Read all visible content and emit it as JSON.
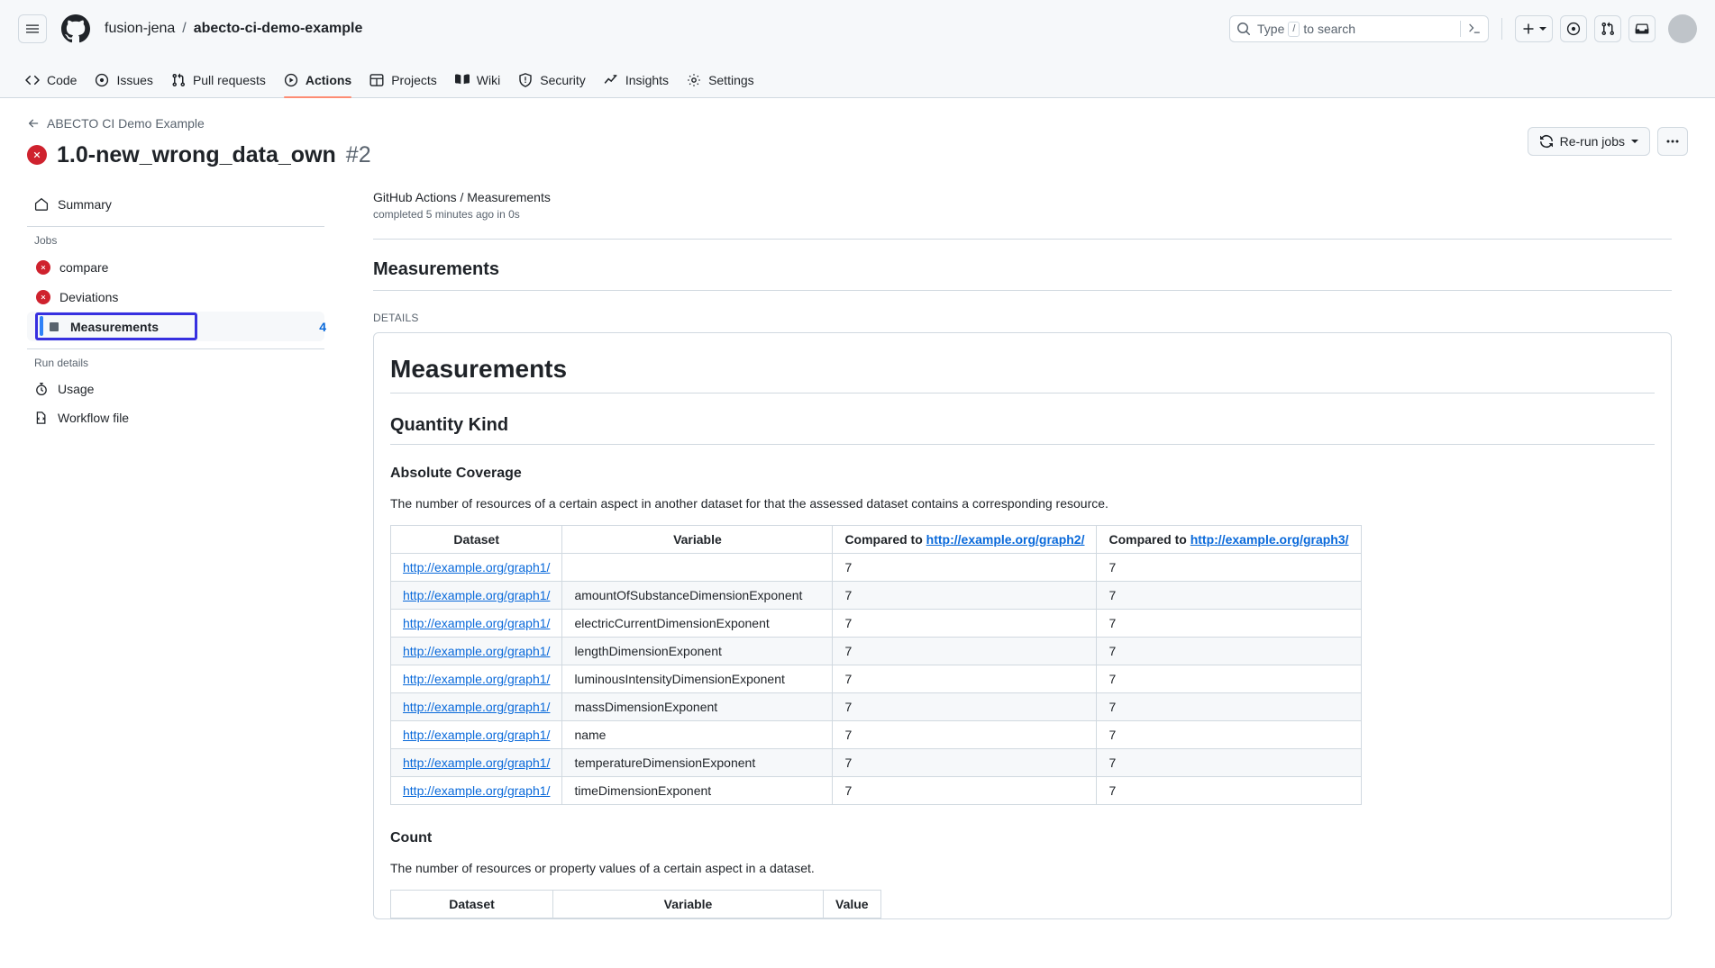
{
  "header": {
    "menu_icon": "hamburger-icon",
    "logo_icon": "github-logo-icon",
    "owner": "fusion-jena",
    "separator": "/",
    "repo": "abecto-ci-demo-example",
    "search_placeholder_pre": "Type",
    "search_key": "/",
    "search_placeholder_post": "to search",
    "terminal_icon": "terminal-icon",
    "create_new_label": "+",
    "issues_icon": "issue-opened-icon",
    "pulls_icon": "git-pull-request-icon",
    "inbox_icon": "inbox-icon",
    "avatar": "user-avatar"
  },
  "repo_nav": {
    "tabs": [
      {
        "label": "Code",
        "icon": "code-icon",
        "active": false
      },
      {
        "label": "Issues",
        "icon": "issue-opened-icon",
        "active": false
      },
      {
        "label": "Pull requests",
        "icon": "git-pull-request-icon",
        "active": false
      },
      {
        "label": "Actions",
        "icon": "play-icon",
        "active": true
      },
      {
        "label": "Projects",
        "icon": "table-icon",
        "active": false
      },
      {
        "label": "Wiki",
        "icon": "book-icon",
        "active": false
      },
      {
        "label": "Security",
        "icon": "shield-icon",
        "active": false
      },
      {
        "label": "Insights",
        "icon": "graph-icon",
        "active": false
      },
      {
        "label": "Settings",
        "icon": "gear-icon",
        "active": false
      }
    ],
    "active_accent": "#fd8c73"
  },
  "run": {
    "back_label": "ABECTO CI Demo Example",
    "back_icon": "arrow-left-icon",
    "status_icon": "x-circle-fill-icon",
    "status_color": "#cf222e",
    "title": "1.0-new_wrong_data_own",
    "number": "#2",
    "rerun_label": "Re-run jobs",
    "rerun_icon": "sync-icon",
    "more_label": "•••"
  },
  "sidebar": {
    "summary": {
      "label": "Summary",
      "icon": "home-icon"
    },
    "jobs_heading": "Jobs",
    "jobs": [
      {
        "label": "compare",
        "icon": "x-circle-fill-icon",
        "status": "failure",
        "count": "",
        "selected": false
      },
      {
        "label": "Deviations",
        "icon": "x-circle-fill-icon",
        "status": "failure",
        "count": "",
        "selected": false
      },
      {
        "label": "Measurements",
        "icon": "neutral-square-icon",
        "status": "neutral",
        "count": "4",
        "selected": true
      }
    ],
    "run_details_heading": "Run details",
    "run_details": [
      {
        "label": "Usage",
        "icon": "stopwatch-icon"
      },
      {
        "label": "Workflow file",
        "icon": "workflow-file-icon"
      }
    ],
    "focus_color": "#3730e0",
    "selected_bar_color": "#2f81f7",
    "count_color": "#0969da"
  },
  "main": {
    "log_title": "GitHub Actions / Measurements",
    "log_subtitle": "completed 5 minutes ago in 0s",
    "section_title": "Measurements",
    "details_label": "DETAILS",
    "doc": {
      "h1": "Measurements",
      "h2": "Quantity Kind",
      "sections": [
        {
          "h3": "Absolute Coverage",
          "paragraph": "The number of resources of a certain aspect in another dataset for that the assessed dataset contains a corresponding resource.",
          "table": {
            "headers": [
              {
                "text": "Dataset",
                "link": ""
              },
              {
                "text": "Variable",
                "link": ""
              },
              {
                "text": "Compared to ",
                "link": "http://example.org/graph2/"
              },
              {
                "text": "Compared to ",
                "link": "http://example.org/graph3/"
              }
            ],
            "rows": [
              {
                "dataset": "http://example.org/graph1/",
                "variable": "",
                "g2": "7",
                "g3": "7"
              },
              {
                "dataset": "http://example.org/graph1/",
                "variable": "amountOfSubstanceDimensionExponent",
                "g2": "7",
                "g3": "7"
              },
              {
                "dataset": "http://example.org/graph1/",
                "variable": "electricCurrentDimensionExponent",
                "g2": "7",
                "g3": "7"
              },
              {
                "dataset": "http://example.org/graph1/",
                "variable": "lengthDimensionExponent",
                "g2": "7",
                "g3": "7"
              },
              {
                "dataset": "http://example.org/graph1/",
                "variable": "luminousIntensityDimensionExponent",
                "g2": "7",
                "g3": "7"
              },
              {
                "dataset": "http://example.org/graph1/",
                "variable": "massDimensionExponent",
                "g2": "7",
                "g3": "7"
              },
              {
                "dataset": "http://example.org/graph1/",
                "variable": "name",
                "g2": "7",
                "g3": "7"
              },
              {
                "dataset": "http://example.org/graph1/",
                "variable": "temperatureDimensionExponent",
                "g2": "7",
                "g3": "7"
              },
              {
                "dataset": "http://example.org/graph1/",
                "variable": "timeDimensionExponent",
                "g2": "7",
                "g3": "7"
              }
            ]
          }
        },
        {
          "h3": "Count",
          "paragraph": "The number of resources or property values of a certain aspect in a dataset.",
          "table": {
            "headers": [
              {
                "text": "Dataset",
                "link": ""
              },
              {
                "text": "Variable",
                "link": ""
              },
              {
                "text": "Value",
                "link": ""
              }
            ],
            "rows": []
          }
        }
      ]
    }
  }
}
